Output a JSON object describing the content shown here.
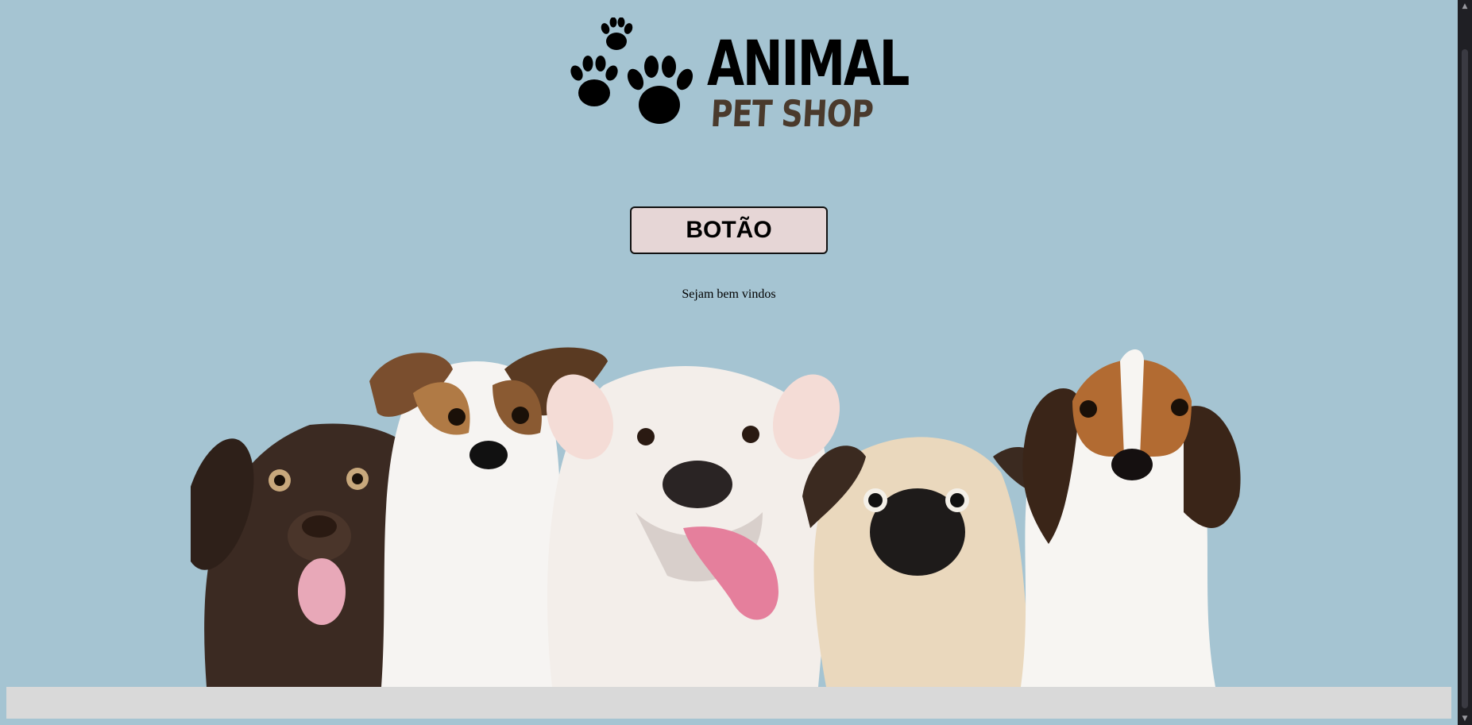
{
  "logo": {
    "word1": "ANIMAL",
    "word2": "PET SHOP",
    "icon": "paw-prints-icon"
  },
  "button": {
    "label": "BOTÃO"
  },
  "welcome_text": "Sejam bem vindos",
  "hero_image": {
    "subject": "five puppies: chocolate labrador, jack russell terrier, english bulldog, pug, beagle"
  },
  "scrollbar": {
    "up_icon": "▲",
    "down_icon": "▼"
  },
  "colors": {
    "background": "#a5c4d2",
    "button_bg": "#e6d6d6",
    "logo_primary": "#000000",
    "logo_secondary": "#4a3a2c",
    "footer_bar": "#d9d9d9"
  }
}
